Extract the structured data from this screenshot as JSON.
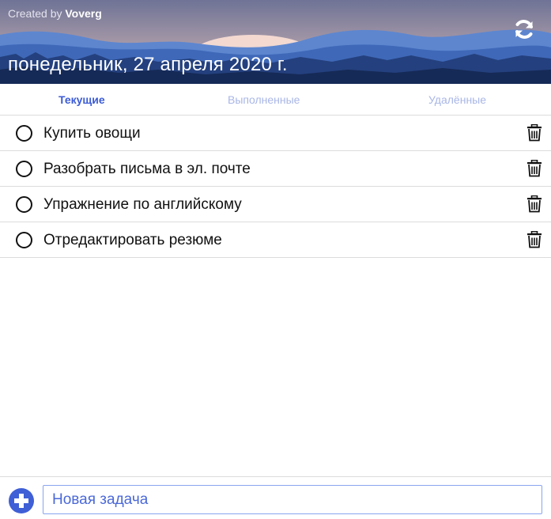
{
  "header": {
    "credit_prefix": "Created by",
    "credit_author": "Voverg",
    "date": "понедельник, 27 апреля 2020 г.",
    "refresh_icon": "refresh-icon"
  },
  "tabs": [
    {
      "label": "Текущие",
      "active": true
    },
    {
      "label": "Выполненные",
      "active": false
    },
    {
      "label": "Удалённые",
      "active": false
    }
  ],
  "tasks": [
    {
      "text": "Купить овощи"
    },
    {
      "text": "Разобрать письма в эл. почте"
    },
    {
      "text": "Упражнение по английскому"
    },
    {
      "text": "Отредактировать резюме"
    }
  ],
  "footer": {
    "add_icon": "plus-circle-icon",
    "input_placeholder": "Новая задача",
    "input_value": ""
  },
  "colors": {
    "accent": "#3b5bd6",
    "tab_inactive": "#a8b6e6",
    "input_border": "#8aa4ef",
    "divider": "#dcdcdc",
    "sky_top": "#6f7396",
    "sun": "#f3d9d0"
  }
}
